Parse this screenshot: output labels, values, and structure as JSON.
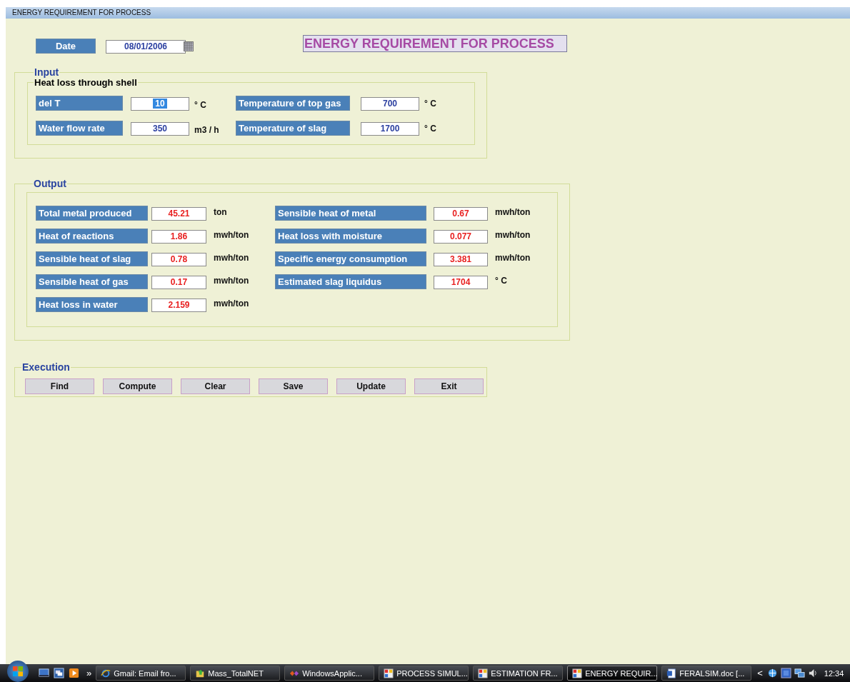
{
  "window": {
    "title": "ENERGY REQUIREMENT FOR PROCESS"
  },
  "date": {
    "label": "Date",
    "value": "08/01/2006"
  },
  "heading": "ENERGY REQUIREMENT FOR PROCESS",
  "input": {
    "legend": "Input",
    "group": {
      "legend": "Heat loss through shell",
      "fields": [
        {
          "label": "del T",
          "value": "10",
          "unit": "° C",
          "selected": true
        },
        {
          "label": "Temperature of top gas",
          "value": "700",
          "unit": "° C",
          "selected": false
        },
        {
          "label": "Water flow rate",
          "value": "350",
          "unit": "m3 / h",
          "selected": false
        },
        {
          "label": "Temperature of slag",
          "value": "1700",
          "unit": "° C",
          "selected": false
        }
      ]
    }
  },
  "output": {
    "legend": "Output",
    "left": [
      {
        "label": "Total metal produced",
        "value": "45.21",
        "unit": "ton"
      },
      {
        "label": "Heat of reactions",
        "value": "1.86",
        "unit": "mwh/ton"
      },
      {
        "label": "Sensible heat of slag",
        "value": "0.78",
        "unit": "mwh/ton"
      },
      {
        "label": "Sensible heat of gas",
        "value": "0.17",
        "unit": "mwh/ton"
      },
      {
        "label": "Heat loss in water",
        "value": "2.159",
        "unit": "mwh/ton"
      }
    ],
    "right": [
      {
        "label": "Sensible heat of metal",
        "value": "0.67",
        "unit": "mwh/ton"
      },
      {
        "label": "Heat loss with moisture",
        "value": "0.077",
        "unit": "mwh/ton"
      },
      {
        "label": "Specific energy consumption",
        "value": "3.381",
        "unit": "mwh/ton"
      },
      {
        "label": "Estimated slag liquidus",
        "value": "1704",
        "unit": "° C"
      }
    ]
  },
  "execution": {
    "legend": "Execution",
    "buttons": [
      "Find",
      "Compute",
      "Clear",
      "Save",
      "Update",
      "Exit"
    ]
  },
  "taskbar": {
    "overflow": "»",
    "tasks": [
      {
        "label": "Gmail: Email fro...",
        "kind": "browser",
        "selected": false
      },
      {
        "label": "Mass_TotalNET",
        "kind": "folder",
        "selected": false
      },
      {
        "label": "WindowsApplic...",
        "kind": "studio",
        "selected": false
      },
      {
        "label": "PROCESS SIMUL...",
        "kind": "app",
        "selected": false
      },
      {
        "label": "ESTIMATION FR...",
        "kind": "app",
        "selected": false
      },
      {
        "label": "ENERGY REQUIR...",
        "kind": "app",
        "selected": true
      },
      {
        "label": "FERALSIM.doc [...",
        "kind": "document",
        "selected": false
      }
    ],
    "tray_arrow": "<",
    "clock": "12:34"
  }
}
